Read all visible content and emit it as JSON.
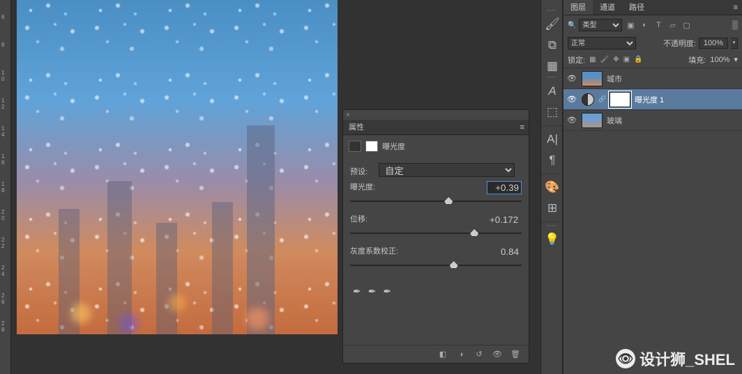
{
  "ruler_ticks": [
    "6",
    "8",
    "1\n0",
    "1\n2",
    "1\n4",
    "1\n6",
    "1\n8",
    "2\n0",
    "2\n2",
    "2\n4",
    "2\n6",
    "2\n8"
  ],
  "properties": {
    "title": "属性",
    "adjustment_name": "曝光度",
    "preset_label": "预设:",
    "preset_value": "自定",
    "exposure_label": "曝光度:",
    "exposure_value": "+0.39",
    "offset_label": "位移:",
    "offset_value": "+0.1723",
    "gamma_label": "灰度系数校正:",
    "gamma_value": "0.84",
    "slider_positions": {
      "exposure": 55,
      "offset": 70,
      "gamma": 58
    },
    "footer_icons": [
      "clip",
      "prev",
      "reset",
      "eye",
      "trash"
    ]
  },
  "mid_tools": [
    "brush",
    "clone",
    "swatch",
    "A-type",
    "cube",
    "|",
    "A|",
    "para",
    "|",
    "palette",
    "grid",
    "|",
    "bulb"
  ],
  "layers_panel": {
    "tabs": [
      "图层",
      "通道",
      "路径"
    ],
    "active_tab": "图层",
    "filter_kind": "类型",
    "filter_icons": [
      "image",
      "adjust",
      "T",
      "shape",
      "smart"
    ],
    "blend_mode": "正常",
    "opacity_label": "不透明度:",
    "opacity_value": "100%",
    "lock_label": "锁定:",
    "lock_icons": [
      "image",
      "brush",
      "move",
      "pos",
      "artb",
      "lock"
    ],
    "fill_label": "填充:",
    "fill_value": "100%",
    "layers": [
      {
        "name": "城市",
        "type": "image",
        "visible": true,
        "selected": false,
        "thumb": "city"
      },
      {
        "name": "曝光度 1",
        "type": "adjustment",
        "visible": true,
        "selected": true,
        "thumb": "mask"
      },
      {
        "name": "玻璃",
        "type": "image",
        "visible": true,
        "selected": false,
        "thumb": "glass"
      }
    ]
  },
  "watermark": "设计狮_SHEL"
}
